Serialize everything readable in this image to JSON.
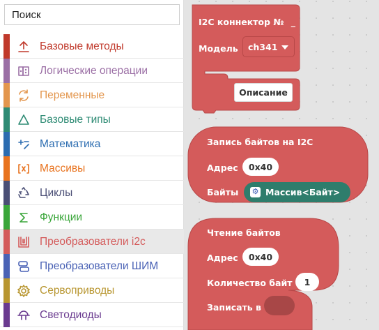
{
  "search": {
    "placeholder": "Поиск"
  },
  "categories": [
    {
      "label": "Базовые методы",
      "color": "#c0392b",
      "icon": "upload-icon"
    },
    {
      "label": "Логические операции",
      "color": "#9b6fa5",
      "icon": "logic-icon"
    },
    {
      "label": "Переменные",
      "color": "#e3964d",
      "icon": "refresh-icon"
    },
    {
      "label": "Базовые типы",
      "color": "#2e8b74",
      "icon": "triangle-icon"
    },
    {
      "label": "Математика",
      "color": "#2b6cb0",
      "icon": "math-icon"
    },
    {
      "label": "Массивы",
      "color": "#e8731f",
      "icon": "array-icon"
    },
    {
      "label": "Циклы",
      "color": "#4a4e75",
      "icon": "recycle-icon"
    },
    {
      "label": "Функции",
      "color": "#3aa63a",
      "icon": "sigma-icon"
    },
    {
      "label": "Преобразователи i2c",
      "color": "#d45b5b",
      "icon": "i2c-icon"
    },
    {
      "label": "Преобразователи ШИМ",
      "color": "#4a62b5",
      "icon": "pwm-icon"
    },
    {
      "label": "Сервоприводы",
      "color": "#b89630",
      "icon": "gear-icon"
    },
    {
      "label": "Светодиоды",
      "color": "#6a3a8f",
      "icon": "led-icon"
    }
  ],
  "active_category": "Преобразователи i2c",
  "blocks": {
    "connector": {
      "title": "I2C коннектор №",
      "title_suffix": "_",
      "model_label": "Модель",
      "model_value": "ch341",
      "description_button": "Описание"
    },
    "write_bytes": {
      "title": "Запись байтов на I2C",
      "address_label": "Адрес",
      "address_value": "0x40",
      "bytes_label": "Байты",
      "bytes_value": "Массив<Байт>"
    },
    "read_bytes": {
      "title": "Чтение байтов",
      "address_label": "Адрес",
      "address_value": "0x40",
      "count_label": "Количество байт",
      "count_value": "1",
      "write_to_label": "Записать в"
    }
  },
  "colors": {
    "block": "#d45b5b",
    "block_stroke": "#b84848",
    "array_chip": "#2e7d6c"
  }
}
